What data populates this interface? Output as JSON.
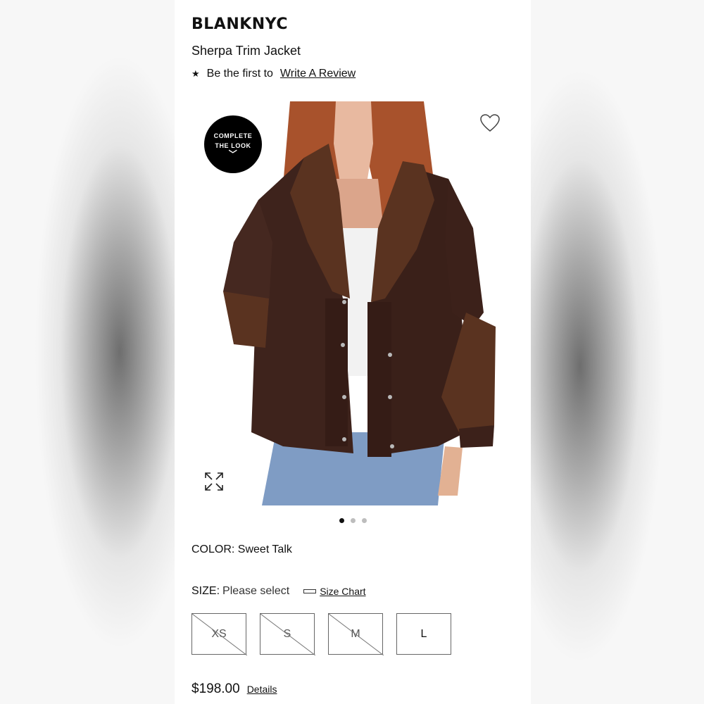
{
  "product": {
    "brand": "BLANKNYC",
    "name": "Sherpa Trim Jacket",
    "review_prefix": "Be the first to",
    "review_link": "Write A Review"
  },
  "image": {
    "complete_look_line1": "COMPLETE",
    "complete_look_line2": "THE LOOK",
    "heart_icon": "heart-icon",
    "expand_icon": "expand-icon",
    "carousel_count": 3,
    "carousel_active": 0
  },
  "color": {
    "label": "COLOR:",
    "value": "Sweet Talk"
  },
  "size": {
    "label": "SIZE:",
    "value": "Please select",
    "chart_link": "Size Chart",
    "options": [
      {
        "label": "XS",
        "available": false
      },
      {
        "label": "S",
        "available": false
      },
      {
        "label": "M",
        "available": false
      },
      {
        "label": "L",
        "available": true
      }
    ]
  },
  "price": {
    "amount": "$198.00",
    "details_link": "Details"
  },
  "colors": {
    "jacket_leather": "#3e231c",
    "sherpa": "#5a3320",
    "denim": "#7f9cc4",
    "hair": "#a8522c"
  }
}
